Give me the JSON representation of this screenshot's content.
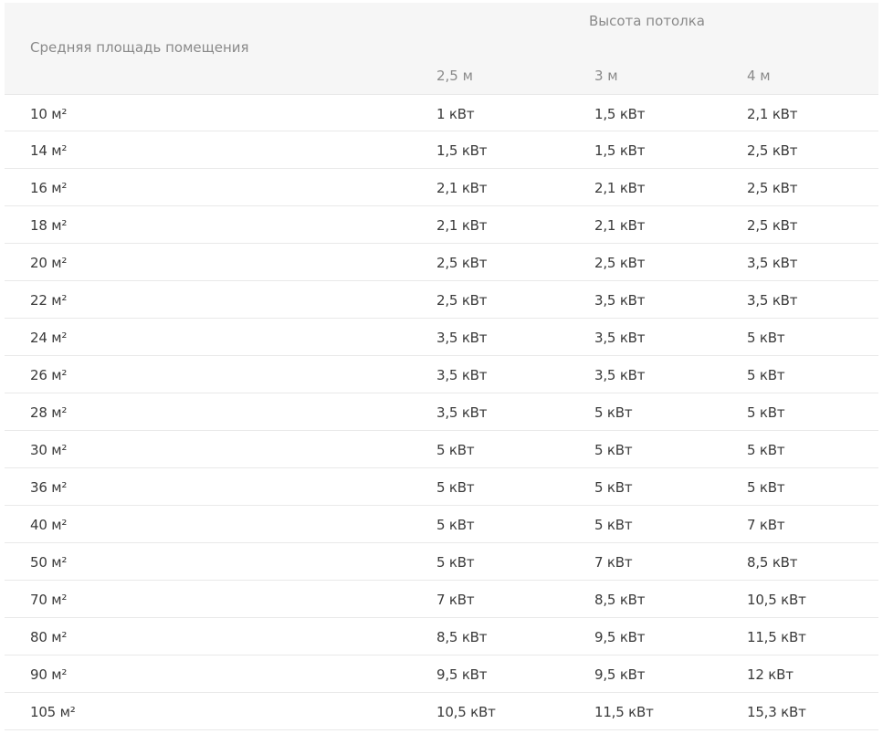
{
  "table": {
    "header": {
      "area_label": "Средняя площадь помещения",
      "ceiling_label": "Высота потолка",
      "columns": [
        "2,5 м",
        "3 м",
        "4 м"
      ]
    },
    "rows": [
      [
        "10 м²",
        "1 кВт",
        "1,5 кВт",
        "2,1 кВт"
      ],
      [
        "14 м²",
        "1,5 кВт",
        "1,5 кВт",
        "2,5 кВт"
      ],
      [
        "16 м²",
        "2,1 кВт",
        "2,1 кВт",
        "2,5 кВт"
      ],
      [
        "18 м²",
        "2,1 кВт",
        "2,1 кВт",
        "2,5 кВт"
      ],
      [
        "20 м²",
        "2,5 кВт",
        "2,5 кВт",
        "3,5 кВт"
      ],
      [
        "22 м²",
        "2,5 кВт",
        "3,5 кВт",
        "3,5 кВт"
      ],
      [
        "24 м²",
        "3,5 кВт",
        "3,5 кВт",
        "5 кВт"
      ],
      [
        "26 м²",
        "3,5 кВт",
        "3,5 кВт",
        "5 кВт"
      ],
      [
        "28 м²",
        "3,5 кВт",
        "5 кВт",
        "5 кВт"
      ],
      [
        "30 м²",
        "5 кВт",
        "5 кВт",
        "5 кВт"
      ],
      [
        "36 м²",
        "5 кВт",
        "5 кВт",
        "5 кВт"
      ],
      [
        "40 м²",
        "5 кВт",
        "5 кВт",
        "7 кВт"
      ],
      [
        "50 м²",
        "5 кВт",
        "7 кВт",
        "8,5 кВт"
      ],
      [
        "70 м²",
        "7 кВт",
        "8,5 кВт",
        "10,5 кВт"
      ],
      [
        "80 м²",
        "8,5 кВт",
        "9,5 кВт",
        "11,5 кВт"
      ],
      [
        "90 м²",
        "9,5 кВт",
        "9,5 кВт",
        "12 кВт"
      ],
      [
        "105 м²",
        "10,5 кВт",
        "11,5 кВт",
        "15,3 кВт"
      ]
    ]
  }
}
